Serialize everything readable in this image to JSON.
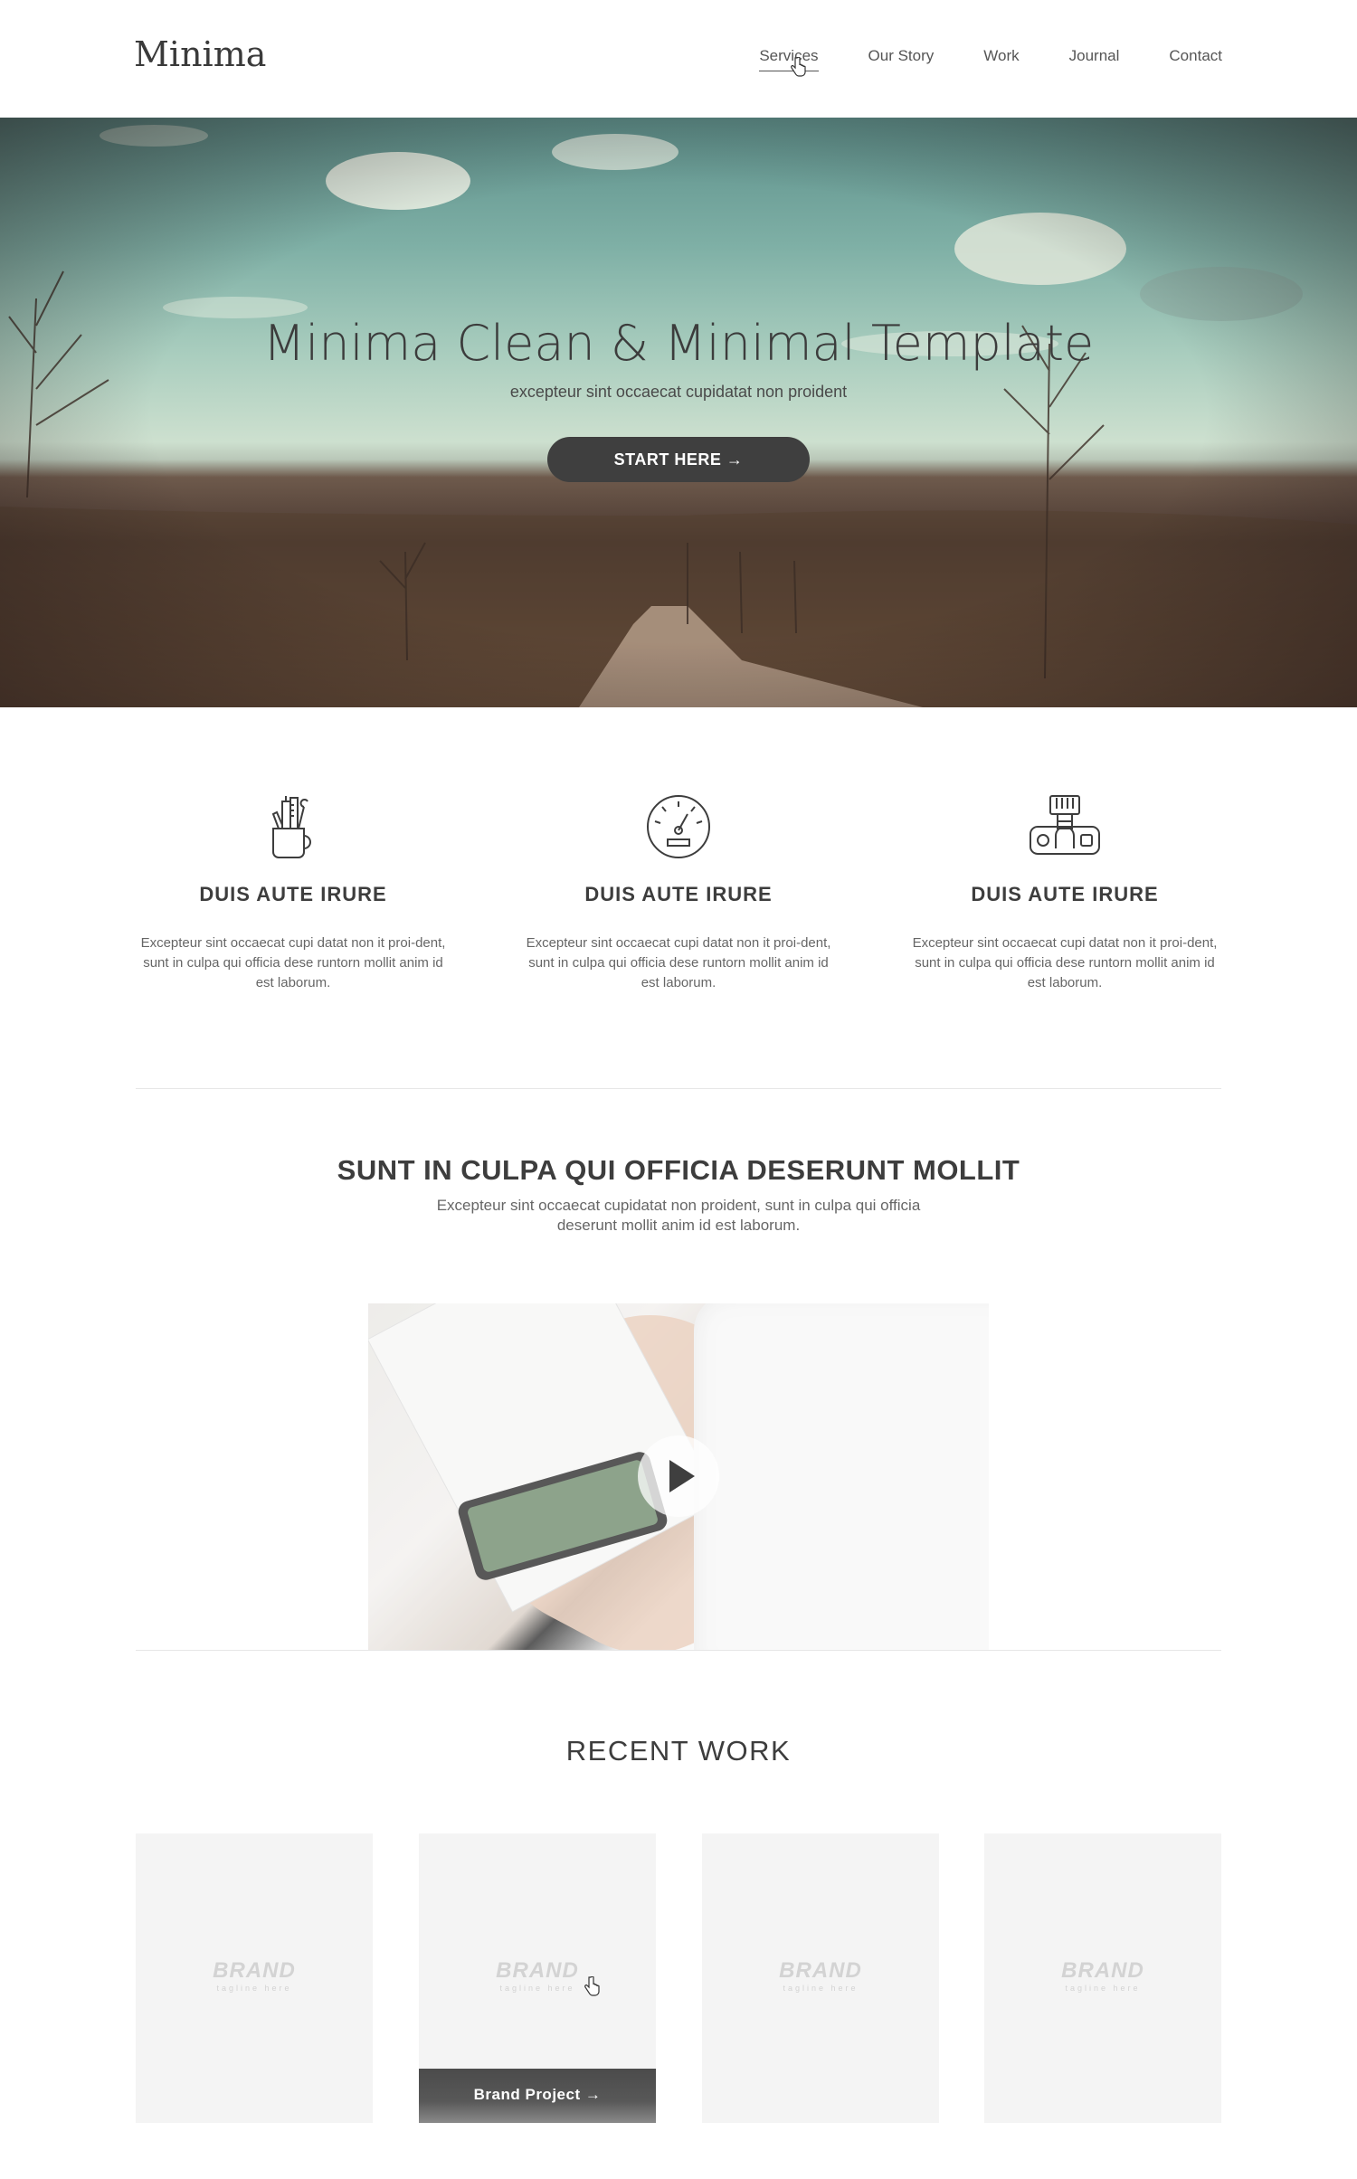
{
  "header": {
    "logo": "Minima",
    "nav": [
      {
        "label": "Services",
        "active": true
      },
      {
        "label": "Our Story"
      },
      {
        "label": "Work"
      },
      {
        "label": "Journal"
      },
      {
        "label": "Contact"
      }
    ]
  },
  "hero": {
    "title": "Minima Clean & Minimal Template",
    "subtitle": "excepteur sint occaecat cupidatat non proident",
    "button_label": "START HERE →"
  },
  "features": [
    {
      "icon": "pencil-cup-icon",
      "title": "DUIS AUTE IRURE",
      "text": "Excepteur sint occaecat cupi datat non it proi-dent, sunt in culpa qui officia dese runtorn mollit anim id est laborum."
    },
    {
      "icon": "speedometer-icon",
      "title": "DUIS AUTE IRURE",
      "text": "Excepteur sint occaecat cupi datat non it proi-dent, sunt in culpa qui officia dese runtorn mollit anim id est laborum."
    },
    {
      "icon": "camera-icon",
      "title": "DUIS AUTE IRURE",
      "text": "Excepteur sint occaecat cupi datat non it proi-dent, sunt in culpa qui officia dese runtorn mollit anim id est laborum."
    }
  ],
  "intro": {
    "title": "SUNT IN CULPA QUI OFFICIA DESERUNT MOLLIT",
    "text": "Excepteur sint occaecat cupidatat non proident, sunt in culpa qui officia deserunt mollit anim id est laborum."
  },
  "video": {
    "icon": "play-icon"
  },
  "recent_work": {
    "title": "RECENT WORK",
    "cards": [
      {
        "brand": "BRAND",
        "tagline": "tagline here"
      },
      {
        "brand": "BRAND",
        "tagline": "tagline here",
        "hover_label": "Brand Project →"
      },
      {
        "brand": "BRAND",
        "tagline": "tagline here"
      },
      {
        "brand": "BRAND",
        "tagline": "tagline here"
      }
    ]
  },
  "colors": {
    "accent": "#3f3f3f",
    "text": "#444444",
    "card_bg": "#f4f4f4"
  }
}
